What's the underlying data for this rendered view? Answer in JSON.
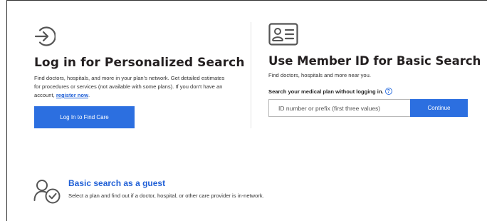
{
  "login": {
    "icon": "login-arrow-icon",
    "title": "Log in for Personalized Search",
    "description": "Find doctors, hospitals, and more in your plan's network. Get detailed estimates for procedures or services (not available with some plans). If you don't have an account, ",
    "register_link": "register now",
    "description_end": ".",
    "button_label": "Log In to Find Care"
  },
  "member": {
    "icon": "id-card-icon",
    "title": "Use Member ID for Basic Search",
    "description": "Find doctors, hospitals and more near you.",
    "search_label": "Search your medical plan without logging in.",
    "help_icon": "help-icon",
    "help_glyph": "?",
    "input_placeholder": "ID number or prefix (first three values)",
    "input_value": "",
    "continue_label": "Continue"
  },
  "guest": {
    "icon": "guest-user-check-icon",
    "title": "Basic search as a guest",
    "description": "Select a plan and find out if a doctor, hospital, or other care provider is in-network."
  },
  "colors": {
    "accent": "#2c6fe0",
    "link": "#1f5fd6",
    "icon": "#555555"
  }
}
